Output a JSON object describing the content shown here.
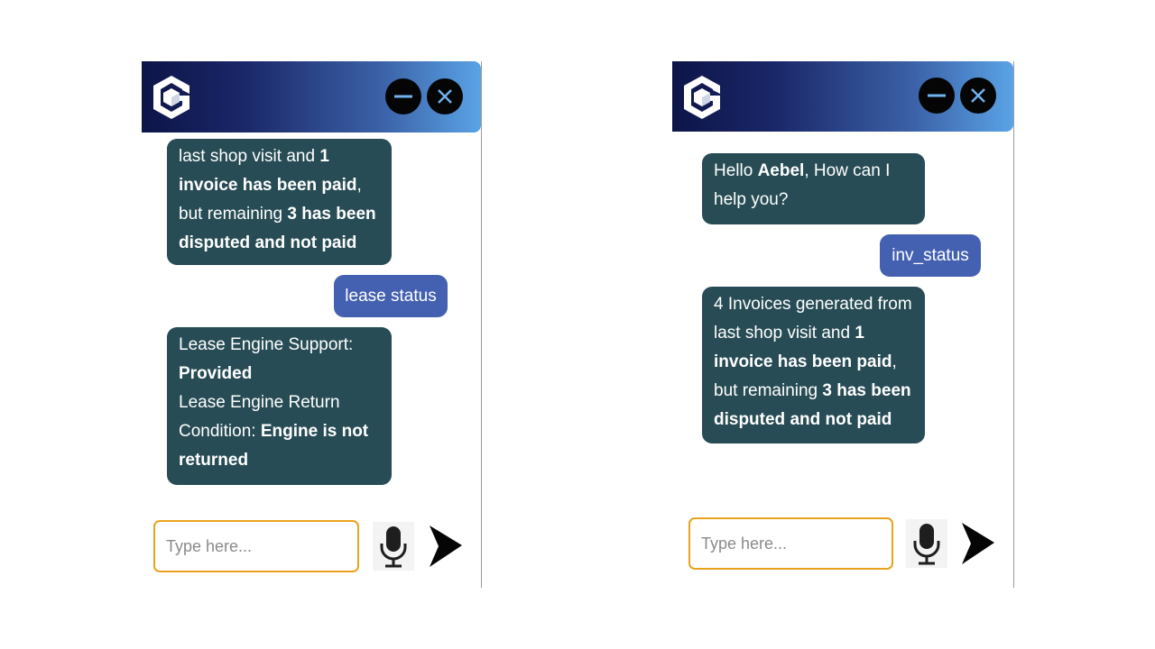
{
  "left": {
    "messages_top": [
      {
        "type": "bot",
        "lines": [
          [
            {
              "t": "last shop visit and "
            },
            {
              "t": "1",
              "b": true
            }
          ],
          [
            {
              "t": "invoice has been paid",
              "b": true
            },
            {
              "t": ","
            }
          ],
          [
            {
              "t": "but remaining "
            },
            {
              "t": "3 has been",
              "b": true
            }
          ],
          [
            {
              "t": "disputed and not paid",
              "b": true
            }
          ]
        ]
      }
    ],
    "user_message": "lease status",
    "bot_reply": {
      "lines": [
        [
          {
            "t": "Lease Engine Support:"
          }
        ],
        [
          {
            "t": "Provided",
            "b": true
          }
        ],
        [
          {
            "t": "Lease Engine Return"
          }
        ],
        [
          {
            "t": "Condition: "
          },
          {
            "t": "Engine is not",
            "b": true
          }
        ],
        [
          {
            "t": "returned",
            "b": true
          }
        ]
      ]
    },
    "input_placeholder": "Type here..."
  },
  "right": {
    "greeting": {
      "lines": [
        [
          {
            "t": "Hello "
          },
          {
            "t": "Aebel",
            "b": true
          },
          {
            "t": ", How can I"
          }
        ],
        [
          {
            "t": "help you?"
          }
        ]
      ]
    },
    "user_message": "inv_status",
    "bot_reply": {
      "lines": [
        [
          {
            "t": "4 Invoices generated from"
          }
        ],
        [
          {
            "t": "last shop visit and "
          },
          {
            "t": "1",
            "b": true
          }
        ],
        [
          {
            "t": "invoice has been paid",
            "b": true
          },
          {
            "t": ","
          }
        ],
        [
          {
            "t": "but remaining "
          },
          {
            "t": "3 has been",
            "b": true
          }
        ],
        [
          {
            "t": "disputed and not paid",
            "b": true
          }
        ]
      ]
    },
    "input_placeholder": "Type here..."
  },
  "icons": {
    "logo": "cube-logo-icon",
    "minimize": "minimize-icon",
    "close": "close-icon",
    "mic": "microphone-icon",
    "send": "send-icon"
  },
  "colors": {
    "bot_bubble": "#274c55",
    "user_bubble": "#4461b1",
    "input_border": "#e9a21f",
    "header_start": "#0d1548",
    "header_end": "#5aa3e6"
  }
}
